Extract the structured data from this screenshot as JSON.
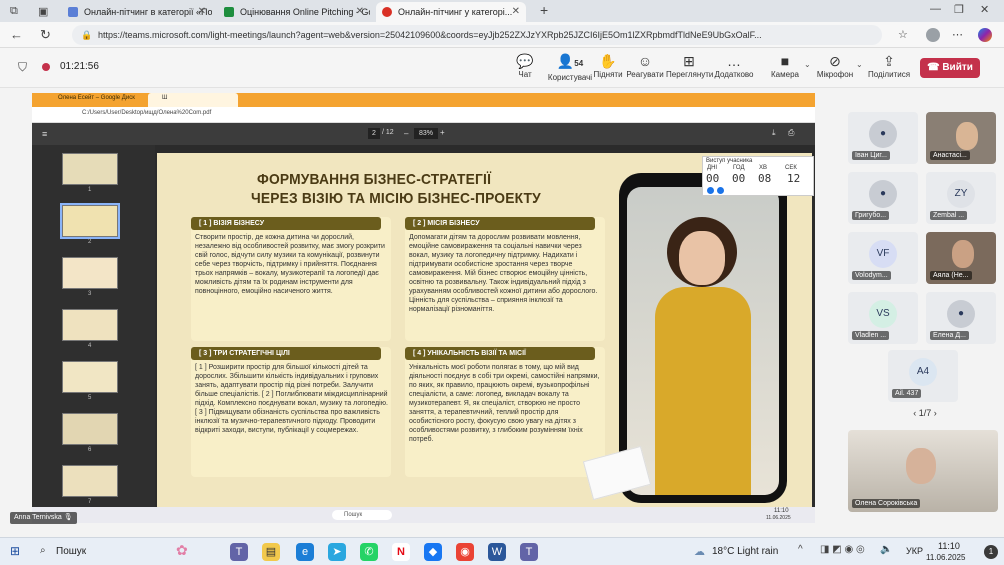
{
  "browser": {
    "tabs": [
      {
        "label": "Онлайн-пітчинг в категорії «По...",
        "active": false,
        "color": "#5b7fd6"
      },
      {
        "label": "Оцінювання Online Pitching - Go...",
        "active": false,
        "color": "#1e8e3e"
      },
      {
        "label": "Онлайн-пітчинг у категорі...",
        "active": true,
        "color": "#d93025"
      }
    ],
    "url": "https://teams.microsoft.com/light-meetings/launch?agent=web&version=25042109600&coords=eyJjb252ZXJzYXRpb25JZCI6IjE5Om1lZXRpbmdfTldNeE9UbGxOalF..."
  },
  "meeting": {
    "timer": "01:21:56",
    "buttons": [
      {
        "label": "Чат",
        "icon": "chat-icon",
        "glyph": "💬"
      },
      {
        "label": "Користувачі",
        "icon": "people-icon",
        "glyph": "👤",
        "badge": "54"
      },
      {
        "label": "Підняти",
        "icon": "raise-hand-icon",
        "glyph": "✋"
      },
      {
        "label": "Реагувати",
        "icon": "react-icon",
        "glyph": "☺"
      },
      {
        "label": "Переглянути",
        "icon": "view-icon",
        "glyph": "⊞"
      },
      {
        "label": "Додатково",
        "icon": "more-icon",
        "glyph": "…"
      },
      {
        "label": "Камера",
        "icon": "camera-icon",
        "glyph": "■"
      },
      {
        "label": "Мікрофон",
        "icon": "mic-off-icon",
        "glyph": "⊘"
      },
      {
        "label": "Поділитися",
        "icon": "share-icon",
        "glyph": "⇪"
      }
    ],
    "leave_label": "Вийти"
  },
  "shared": {
    "inner_tabs": [
      "Олена Есейт – Google Диск",
      "Ш"
    ],
    "file_path": "C:/Users/User/Desktop/ищд/Олена%20Com.pdf",
    "page": "2",
    "page_total": "/ 12",
    "zoom": "83%",
    "thumb_numbers": [
      "1",
      "2",
      "3",
      "4",
      "5",
      "6",
      "7"
    ],
    "presenter": "Anna Ternivska",
    "timer_panel": {
      "title": "Виступ учасника",
      "labels": [
        "ДНІ",
        "ГОД",
        "ХВ",
        "СЕК"
      ],
      "values": [
        "00",
        "00",
        "08",
        "12"
      ]
    },
    "inner_clock": "11:10",
    "inner_date": "11.06.2025"
  },
  "slide": {
    "title1": "ФОРМУВАННЯ БІЗНЕС-СТРАТЕГІЇ",
    "title2": "ЧЕРЕЗ ВІЗІЮ ТА МІСІЮ БІЗНЕС-ПРОЕКТУ",
    "sections": [
      {
        "head": "[ 1 ] ВІЗІЯ БІЗНЕСУ",
        "text": "Створити простір, де кожна дитина чи дорослий, незалежно від особливостей розвитку, має змогу розкрити свій голос, відчути силу музики та комунікації, розвинути себе через творчість, підтримку і прийняття. Поєднання трьох напрямків – вокалу, музикотерапії та логопедії дає можливість дітям та їх родинам інструменти для повноцінного, емоційно насиченого життя."
      },
      {
        "head": "[ 2 ] МІСІЯ БІЗНЕСУ",
        "text": "Допомагати дітям та дорослим розвивати мовлення, емоційне самовираження та соціальні навички через вокал, музику та логопедичну підтримку. Надихати і підтримувати особистісне зростання через творче самовираження. Мій бізнес створює емоційну цінність, освітню та розвивальну. Також індивідуальний підхід з урахуванням особливостей кожної дитини або дорослого. Цінність для суспільства – сприяння інклюзії та нормалізації різноманіття."
      },
      {
        "head": "[ 3 ] ТРИ СТРАТЕГІЧНІ ЦІЛІ",
        "text": "[ 1 ] Розширити простір для більшої кількості дітей та дорослих. Збільшити кількість індивідуальних і групових занять, адаптувати простір під різні потреби. Залучити більше спеціалістів. [ 2 ] Поглиблювати міждисциплінарний підхід. Комплексно поєднувати вокал, музику та логопедію. [ 3 ] Підвищувати обізнаність суспільства про важливість інклюзії та музично-терапевтичного підходу. Проводити відкриті заходи, виступи, публікації у соцмережах."
      },
      {
        "head": "[ 4 ] УНІКАЛЬНІСТЬ ВІЗІЇ ТА МІСІЇ",
        "text": "Унікальність моєї роботи полягає в тому, що мій вид діяльності поєднує в собі три окремі, самостійні напрямки, по яких, як правило, працюють окремі, вузькопрофільні спеціалісти, а саме: логопед, викладач вокалу та музикотерапевт. Я, як спеціаліст, створюю не просто заняття, а терапевтичний, теплий простір для особистісного росту, фокусую свою увагу на дітях з особливостями розвитку, з глибоким розумінням їхніх потреб."
      }
    ]
  },
  "participants": [
    {
      "name": "Іван Циг...",
      "initials": "",
      "kind": "avatar",
      "bg": "#c8ccd3"
    },
    {
      "name": "Анастасі...",
      "initials": "",
      "kind": "video",
      "bg": "#8a7f74"
    },
    {
      "name": "Григубо...",
      "initials": "",
      "kind": "avatar",
      "bg": "#c8ccd3"
    },
    {
      "name": "Zembal ...",
      "initials": "ZY",
      "kind": "avatar",
      "bg": "#dfe2e7"
    },
    {
      "name": "Volodym...",
      "initials": "VF",
      "kind": "avatar",
      "bg": "#d7ddf4"
    },
    {
      "name": "Аяла (Не...",
      "initials": "",
      "kind": "video",
      "bg": "#7b6a5c"
    },
    {
      "name": "Vladlen ...",
      "initials": "VS",
      "kind": "avatar",
      "bg": "#d4efe4"
    },
    {
      "name": "Елена Д...",
      "initials": "",
      "kind": "avatar",
      "bg": "#c8ccd3"
    },
    {
      "name": "Ail. 437",
      "initials": "A4",
      "kind": "avatar",
      "bg": "#dbe6f1"
    }
  ],
  "pager": "1/7",
  "self_view": {
    "name": "Олена Сороківська"
  },
  "taskbar": {
    "search": "Пошук",
    "weather": "18°C  Light rain",
    "lang": "УКР",
    "time": "11:10",
    "date": "11.06.2025"
  }
}
